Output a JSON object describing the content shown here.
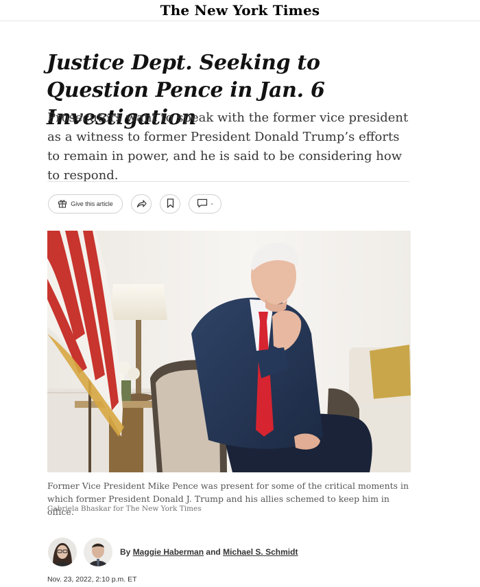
{
  "masthead": {
    "logo_text": "The New York Times"
  },
  "article": {
    "headline": "Justice Dept. Seeking to Question Pence in Jan. 6 Investigation",
    "summary": "Prosecutors want to speak with the former vice president as a witness to former President Donald Trump’s efforts to remain in power, and he is said to be considering how to respond.",
    "photo": {
      "caption": "Former Vice President Mike Pence was present for some of the critical moments in which former President Donald J. Trump and his allies schemed to keep him in office.",
      "credit": "Gabriela Bhaskar for The New York Times"
    },
    "byline": {
      "prefix": "By",
      "author1": "Maggie Haberman",
      "and": "and",
      "author2": "Michael S. Schmidt"
    },
    "dateline": "Nov. 23, 2022, 2:10 p.m. ET"
  },
  "toolbar": {
    "gift_label": "Give this article",
    "comments_suffix": "-",
    "icons": [
      "gift-icon",
      "share-icon",
      "bookmark-icon",
      "comment-icon"
    ]
  },
  "colors": {
    "text": "#121212",
    "muted": "#727272",
    "flag_red": "#c8342e",
    "tie_red": "#d62431"
  }
}
